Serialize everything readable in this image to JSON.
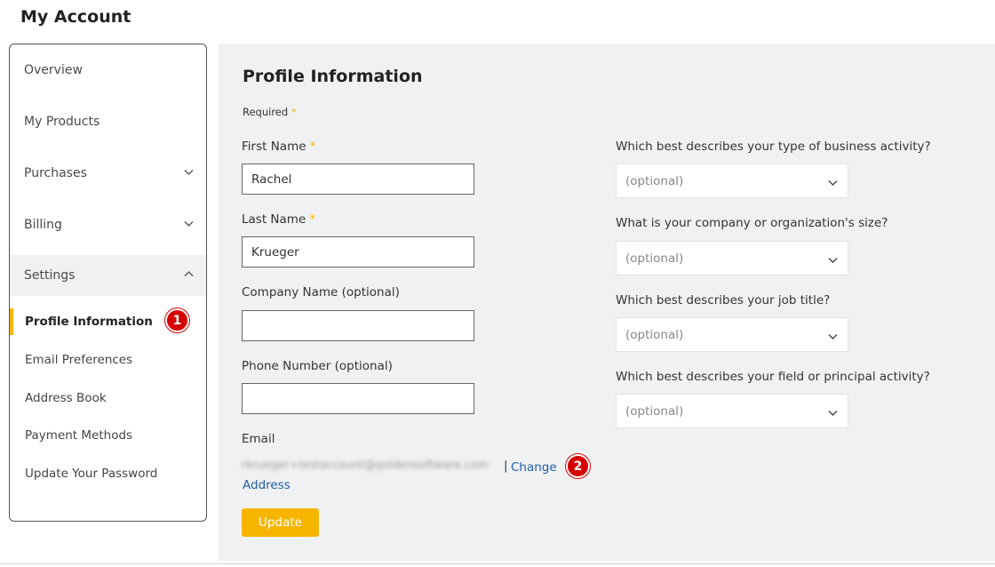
{
  "page": {
    "title": "My Account"
  },
  "sidebar": {
    "items": [
      {
        "label": "Overview"
      },
      {
        "label": "My Products"
      },
      {
        "label": "Purchases"
      },
      {
        "label": "Billing"
      },
      {
        "label": "Settings"
      }
    ],
    "settings_sub": [
      {
        "label": "Profile Information"
      },
      {
        "label": "Email Preferences"
      },
      {
        "label": "Address Book"
      },
      {
        "label": "Payment Methods"
      },
      {
        "label": "Update Your Password"
      }
    ]
  },
  "badges": {
    "one": "1",
    "two": "2"
  },
  "form": {
    "title": "Profile Information",
    "required_note": "Required",
    "required_mark": "*",
    "first_name_label": "First Name",
    "first_name_value": "Rachel",
    "last_name_label": "Last Name",
    "last_name_value": "Krueger",
    "company_label": "Company Name (optional)",
    "company_value": "",
    "phone_label": "Phone Number (optional)",
    "phone_value": "",
    "email_label": "Email",
    "email_value": "rkrueger+testaccount@goldensoftware.com",
    "email_separator": "|",
    "change_link": "Change Address",
    "update_button": "Update"
  },
  "questions": [
    {
      "label": "Which best describes your type of business activity?",
      "value": "(optional)"
    },
    {
      "label": "What is your company or organization's size?",
      "value": "(optional)"
    },
    {
      "label": "Which best describes your job title?",
      "value": "(optional)"
    },
    {
      "label": "Which best describes your field or principal activity?",
      "value": "(optional)"
    }
  ],
  "colors": {
    "accent": "#f7b500",
    "link": "#1f5fa6",
    "badge": "#d60000",
    "panel": "#f0f1f3"
  }
}
